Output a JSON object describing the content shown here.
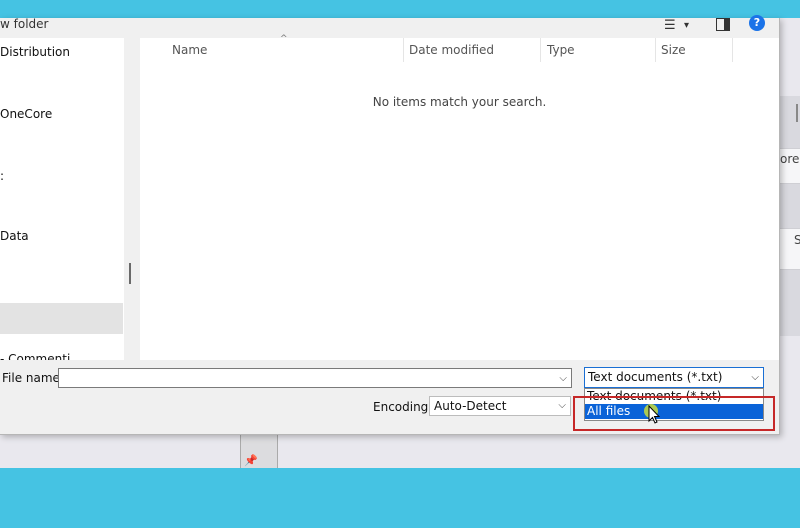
{
  "toolbar": {
    "new_folder_label": "w folder",
    "view_icon": "list-view-icon",
    "view_chevron": "▾",
    "pane_icon": "preview-pane-icon",
    "help_label": "?"
  },
  "nav": {
    "items": [
      {
        "label": "Distribution"
      },
      {
        "label": "OneCore"
      },
      {
        "label": ":"
      },
      {
        "label": "Data"
      },
      {
        "label": "- Commenti"
      }
    ]
  },
  "file_list": {
    "columns": [
      {
        "label": "Name"
      },
      {
        "label": "Date modified"
      },
      {
        "label": "Type"
      },
      {
        "label": "Size"
      }
    ],
    "empty_message": "No items match your search."
  },
  "form": {
    "file_name_label": "File name:",
    "file_name_value": "",
    "encoding_label": "Encoding:",
    "encoding_value": "Auto-Detect",
    "file_type_value": "Text documents (*.txt)",
    "file_type_options": [
      {
        "label": "Text documents (*.txt)"
      },
      {
        "label": "All files"
      }
    ]
  },
  "background": {
    "partial_text_1": "ore",
    "partial_text_2": "S"
  },
  "colors": {
    "accent": "#0a63d8",
    "highlight_border": "#c62828",
    "backdrop": "#45c3e3"
  }
}
